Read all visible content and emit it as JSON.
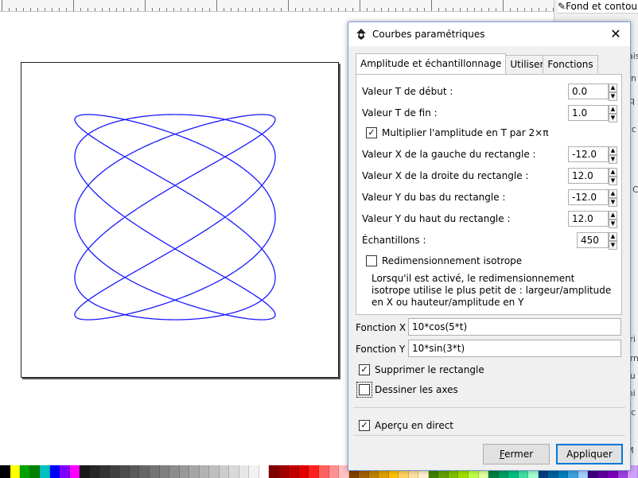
{
  "app": {
    "right_panel_title": "Fond et contour",
    "right_panel_fragments": [
      "nte",
      "ais",
      "n",
      "q",
      "ac",
      "C",
      "tri",
      "orn",
      "ou",
      "mi",
      "l'c",
      "(M"
    ]
  },
  "dialog": {
    "title": "Courbes paramétriques",
    "close_label": "✕",
    "tabs": [
      {
        "label": "Amplitude et échantillonnage",
        "active": true
      },
      {
        "label": "Utiliser",
        "active": false
      },
      {
        "label": "Fonctions",
        "active": false
      }
    ],
    "fields": {
      "t_start": {
        "label": "Valeur T de début :",
        "value": "0.0"
      },
      "t_end": {
        "label": "Valeur T de fin :",
        "value": "1.0"
      },
      "mult_2pi": {
        "label": "Multiplier l'amplitude en T par 2×π",
        "checked": true
      },
      "x_left": {
        "label": "Valeur X de la gauche du rectangle :",
        "value": "-12.0"
      },
      "x_right": {
        "label": "Valeur X de la droite du rectangle :",
        "value": "12.0"
      },
      "y_bottom": {
        "label": "Valeur Y du bas du rectangle :",
        "value": "-12.0"
      },
      "y_top": {
        "label": "Valeur Y du haut du rectangle :",
        "value": "12.0"
      },
      "samples": {
        "label": "Échantillons :",
        "value": "450"
      },
      "isotropic": {
        "label": "Redimensionnement isotrope",
        "checked": false
      },
      "isotropic_help": [
        "Lorsqu'il est activé, le redimensionnement",
        "isotrope utilise le plus petit de : largeur/amplitude",
        "en X ou hauteur/amplitude en Y"
      ]
    },
    "functions": {
      "fx_label": "Fonction X :",
      "fx_value": "10*cos(5*t)",
      "fy_label": "Fonction Y :",
      "fy_value": "10*sin(3*t)"
    },
    "options": {
      "remove_rect": {
        "label": "Supprimer le rectangle",
        "checked": true
      },
      "draw_axes": {
        "label": "Dessiner les axes",
        "checked": false
      },
      "live_preview": {
        "label": "Aperçu en direct",
        "checked": true
      }
    },
    "buttons": {
      "close_first": "F",
      "close_rest": "ermer",
      "apply": "Appliquer"
    }
  },
  "curve": {
    "color": "#1a1aff",
    "amplitude": 10,
    "fx_freq": 5,
    "fy_freq": 3,
    "samples": 450
  },
  "palette": [
    "#000000",
    "#ffff00",
    "#00a000",
    "#008000",
    "#00c0c0",
    "#0000ff",
    "#8000ff",
    "#ff00ff",
    "#1a1a1a",
    "#262626",
    "#333333",
    "#404040",
    "#4d4d4d",
    "#595959",
    "#666666",
    "#737373",
    "#808080",
    "#8c8c8c",
    "#999999",
    "#a6a6a6",
    "#b3b3b3",
    "#bfbfbf",
    "#cccccc",
    "#d9d9d9",
    "#e6e6e6",
    "#f2f2f2",
    "#ffffff",
    "#800000",
    "#a00000",
    "#c00000",
    "#e00000",
    "#ff2020",
    "#ff6060",
    "#ff9090",
    "#ffc0c0",
    "#804000",
    "#a06000",
    "#c08000",
    "#e0a000",
    "#ffc000",
    "#ffd060",
    "#ffe0a0",
    "#fff0d0",
    "#408000",
    "#60a000",
    "#80c000",
    "#a0e000",
    "#c0ff40",
    "#e0ffa0",
    "#008040",
    "#00a060",
    "#00c080",
    "#40e0a0",
    "#a0ffd0",
    "#004080",
    "#0060a0",
    "#0080c0",
    "#40a0e0",
    "#a0d0ff",
    "#400080",
    "#6000a0",
    "#8000c0",
    "#a040e0",
    "#d0a0ff"
  ]
}
